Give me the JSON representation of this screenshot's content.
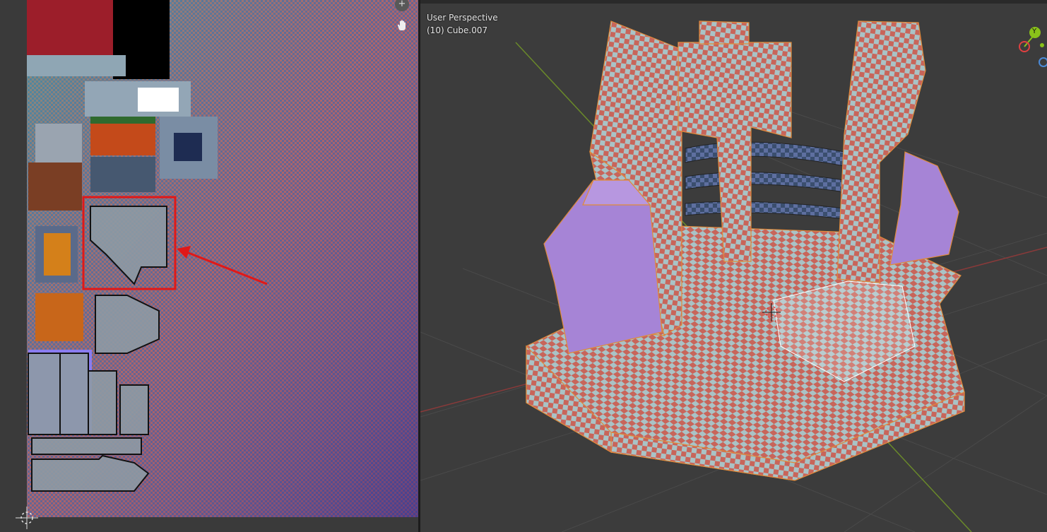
{
  "viewport": {
    "perspective_label": "User Perspective",
    "object_label": "(10) Cube.007",
    "gizmo_axis_y": "Y"
  },
  "uv_editor": {
    "zoom_icon": "zoom-in-icon",
    "pan_icon": "hand-pan-icon",
    "cursor_icon": "2d-cursor-icon"
  },
  "annotation": {
    "highlight_color": "#e01818"
  },
  "colors": {
    "checker_red": "#c8655a",
    "checker_light": "#a9c3c6",
    "face_purple": "#a684d6",
    "edge_orange": "#e08a3a"
  }
}
